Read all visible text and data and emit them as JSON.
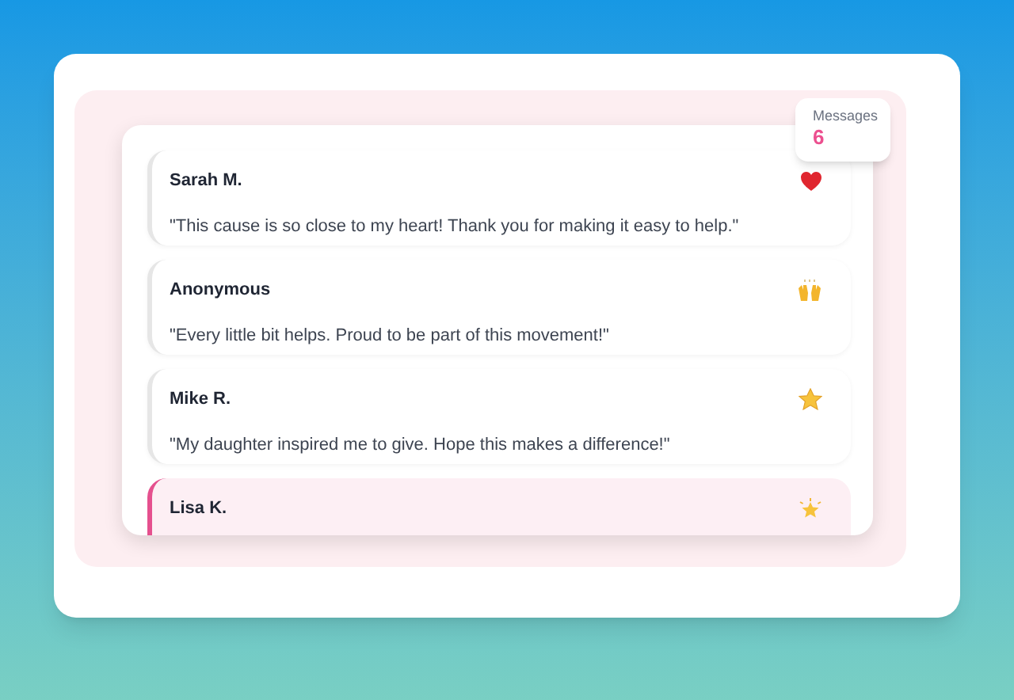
{
  "counter": {
    "label": "Messages",
    "value": "6"
  },
  "messages": [
    {
      "name": "Sarah M.",
      "text": "\"This cause is so close to my heart! Thank you for making it easy to help.\"",
      "kind": "heart",
      "selected": false
    },
    {
      "name": "Anonymous",
      "text": "\"Every little bit helps. Proud to be part of this movement!\"",
      "kind": "hands",
      "selected": false
    },
    {
      "name": "Mike R.",
      "text": "\"My daughter inspired me to give. Hope this makes a difference!\"",
      "kind": "star",
      "selected": false
    },
    {
      "name": "Lisa K.",
      "kind": "glow",
      "selected": true
    }
  ]
}
